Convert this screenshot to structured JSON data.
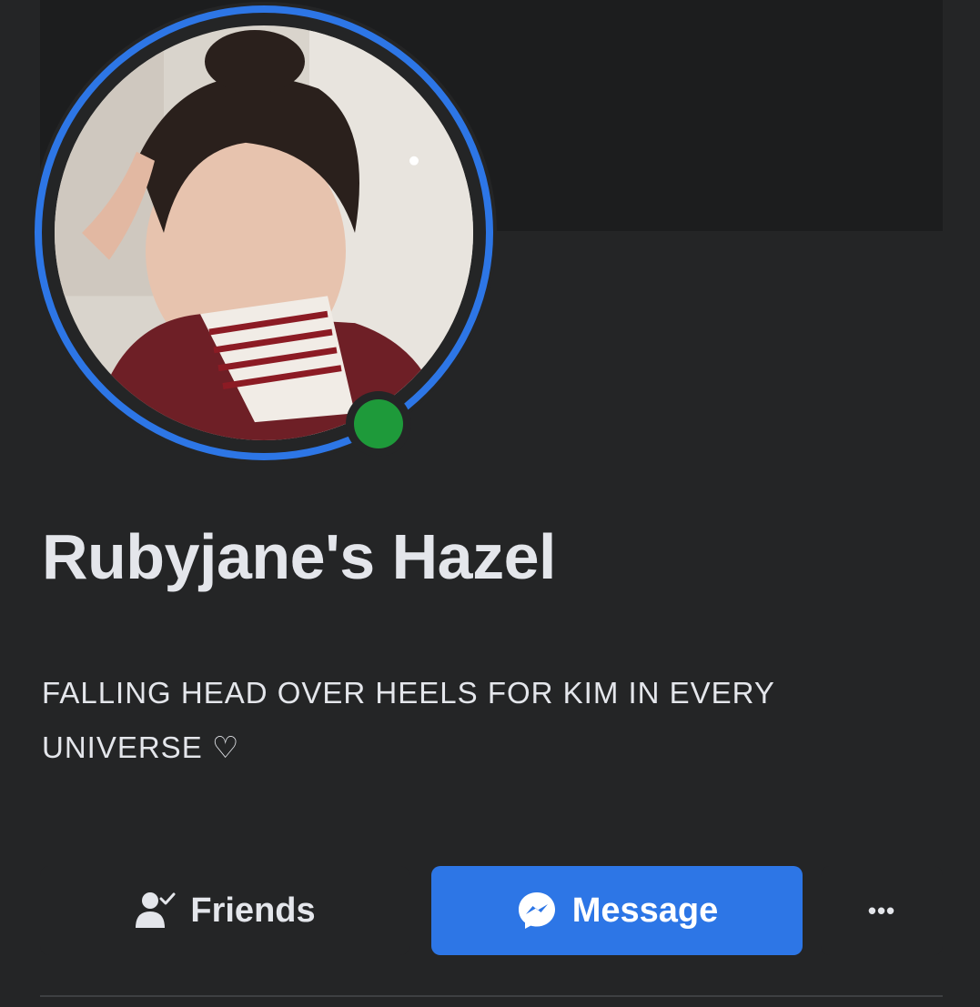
{
  "profile": {
    "name": "Rubyjane's Hazel",
    "bio": "FALLING HEAD OVER HEELS FOR KIM IN EVERY UNIVERSE ♡",
    "online": true
  },
  "actions": {
    "friends_label": "Friends",
    "message_label": "Message",
    "more_label": "•••"
  },
  "colors": {
    "background": "#242526",
    "accent": "#2d76e6",
    "online": "#1e9a3a"
  },
  "icons": {
    "friends": "friends-check-icon",
    "message": "messenger-icon",
    "more": "more-dots-icon"
  }
}
